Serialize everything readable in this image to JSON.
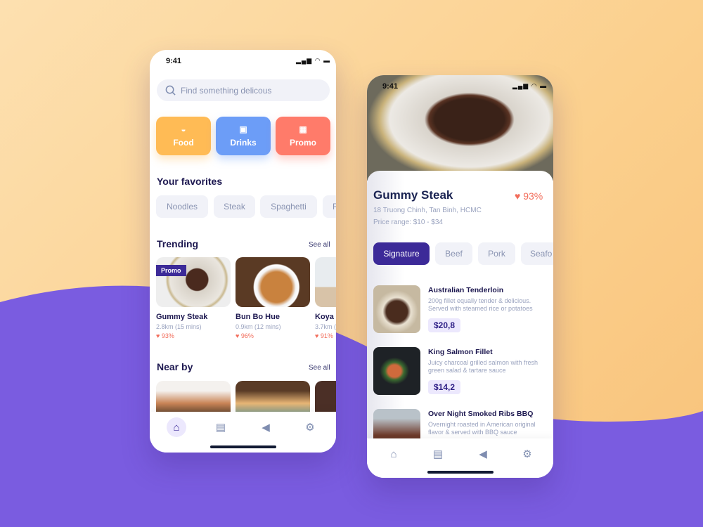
{
  "colors": {
    "accent": "#3c2a98",
    "food": "#ffbb55",
    "drinks": "#6c9df7",
    "promo": "#ff7b6a",
    "heart": "#f26d5b",
    "purple_bg": "#7a5ce0"
  },
  "home": {
    "status_time": "9:41",
    "search": {
      "placeholder": "Find something delicous",
      "icon": "search-icon"
    },
    "categories": [
      {
        "label": "Food",
        "icon": "bowl-icon"
      },
      {
        "label": "Drinks",
        "icon": "cup-icon"
      },
      {
        "label": "Promo",
        "icon": "ticket-icon"
      }
    ],
    "favorites_title": "Your favorites",
    "favorites": [
      "Noodles",
      "Steak",
      "Spaghetti",
      "R"
    ],
    "trending_title": "Trending",
    "see_all": "See all",
    "trending": [
      {
        "name": "Gummy Steak",
        "distance": "2.8km (15 mins)",
        "rating": "93%",
        "badge": "Promo"
      },
      {
        "name": "Bun Bo Hue",
        "distance": "0.9km (12 mins)",
        "rating": "96%"
      },
      {
        "name": "Koya",
        "distance": "3.7km (",
        "rating": "91%"
      }
    ],
    "nearby_title": "Near by",
    "nav": [
      "home-icon",
      "receipt-icon",
      "megaphone-icon",
      "gear-icon"
    ]
  },
  "detail": {
    "status_time": "9:41",
    "name": "Gummy Steak",
    "rating": "93%",
    "address": "18 Truong Chinh, Tan Binh, HCMC",
    "price_range": "Price range: $10 - $34",
    "tabs": [
      "Signature",
      "Beef",
      "Pork",
      "Seafo"
    ],
    "items": [
      {
        "title": "Australian Tenderloin",
        "desc": "200g fillet equally tender & delicious. Served with steamed rice or potatoes",
        "price": "$20,8"
      },
      {
        "title": "King Salmon Fillet",
        "desc": "Juicy charcoal grilled salmon with fresh green salad & tartare sauce",
        "price": "$14,2"
      },
      {
        "title": "Over Night Smoked Ribs BBQ",
        "desc": "Overnight roasted in American original flavor & served with BBQ sauce"
      }
    ]
  }
}
